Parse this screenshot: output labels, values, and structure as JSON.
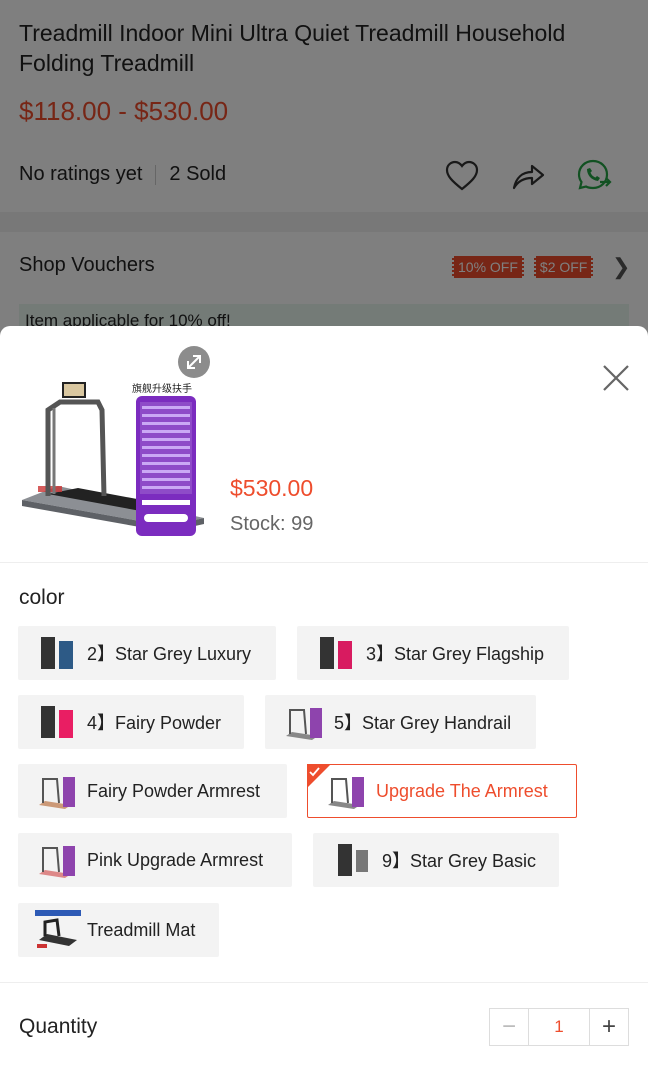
{
  "product": {
    "title": "Treadmill Indoor Mini Ultra Quiet Treadmill Household Folding Treadmill",
    "price_range": "$118.00 - $530.00",
    "rating_text": "No ratings yet",
    "sold_text": "2 Sold"
  },
  "vouchers": {
    "label": "Shop Vouchers",
    "tags": [
      "10% OFF",
      "$2 OFF"
    ],
    "applicable_text": "Item applicable for 10% off!"
  },
  "sheet": {
    "price": "$530.00",
    "stock": "Stock: 99",
    "image_caption": "旗舰升级扶手",
    "color_label": "color",
    "variants": [
      {
        "label": "2】Star Grey Luxury",
        "selected": false
      },
      {
        "label": "3】Star Grey Flagship",
        "selected": false
      },
      {
        "label": "4】Fairy Powder",
        "selected": false
      },
      {
        "label": "5】Star Grey Handrail",
        "selected": false
      },
      {
        "label": "Fairy Powder Armrest",
        "selected": false
      },
      {
        "label": "Upgrade The Armrest",
        "selected": true
      },
      {
        "label": "Pink Upgrade Armrest",
        "selected": false
      },
      {
        "label": "9】Star Grey Basic",
        "selected": false
      },
      {
        "label": "Treadmill Mat",
        "selected": false
      }
    ],
    "quantity_label": "Quantity",
    "quantity_value": "1",
    "minus": "−",
    "plus": "+"
  },
  "colors": {
    "accent": "#ee4d2d",
    "whatsapp": "#25a244",
    "voucher_bg": "#e8f6ef"
  },
  "icons": [
    "heart-icon",
    "share-icon",
    "whatsapp-icon",
    "close-icon",
    "expand-icon",
    "chevron-right-icon"
  ]
}
